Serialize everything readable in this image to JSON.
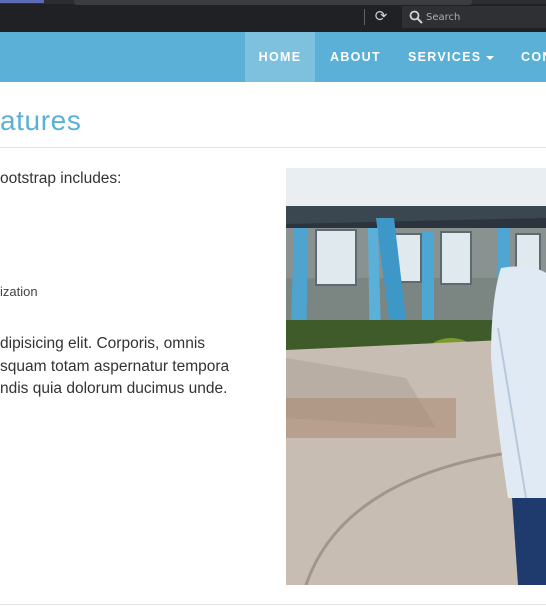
{
  "browser": {
    "search_placeholder": "Search"
  },
  "navbar": {
    "items": [
      {
        "label": "HOME",
        "active": true
      },
      {
        "label": "ABOUT"
      },
      {
        "label": "SERVICES"
      },
      {
        "label": "CON"
      }
    ]
  },
  "page": {
    "title": "atures",
    "intro": "ootstrap includes:",
    "list_item": "ization",
    "paragraph_lines": [
      "dipisicing elit. Corporis, omnis",
      "squam totam aspernatur tempora",
      "ndis quia dolorum ducimus unde."
    ]
  },
  "colors": {
    "navbar": "#5ab0d6",
    "navbar_active": "#7ec1df",
    "title": "#5ab0d6",
    "chrome": "#202124"
  }
}
